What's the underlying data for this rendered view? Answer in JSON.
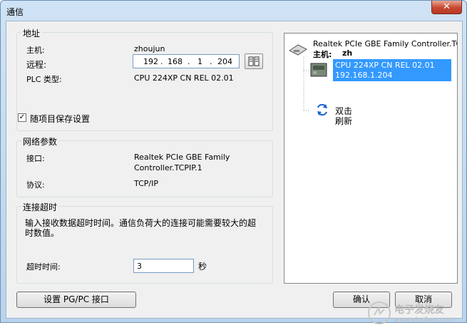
{
  "window": {
    "title": "通信",
    "close_label": "✕"
  },
  "address_group": {
    "title": "地址",
    "host_label": "主机:",
    "host_value": "zhoujun",
    "remote_label": "远程:",
    "ip": [
      "192",
      "168",
      "1",
      "204"
    ],
    "plc_type_label": "PLC 类型:",
    "plc_type_value": "CPU 224XP CN REL 02.01",
    "save_checkbox_label": "随项目保存设置",
    "save_checked": true
  },
  "network_group": {
    "title": "网络参数",
    "interface_label": "接口:",
    "interface_value_line1": "Realtek PCIe GBE Family",
    "interface_value_line2": "Controller.TCPIP.1",
    "protocol_label": "协议:",
    "protocol_value": "TCP/IP"
  },
  "timeout_group": {
    "title": "连接超时",
    "description_line1": "输入接收数据超时时间。通信负荷大的连接可能需要较大的超",
    "description_line2": "时数值。",
    "timeout_label": "超时时间:",
    "timeout_value": "3",
    "unit": "秒"
  },
  "buttons": {
    "set_pgpc": "设置 PG/PC 接口",
    "confirm": "确认",
    "cancel": "取消"
  },
  "tree": {
    "root_label": "Realtek PCIe GBE Family Controller.TCPI",
    "host_prefix": "主机:",
    "host_value": "zh",
    "device_line1": "CPU 224XP CN REL 02.01",
    "device_line2": "192.168.1.204",
    "refresh_line1": "双击",
    "refresh_line2": "刷新"
  },
  "watermark": {
    "text": "电子发烧友",
    "sub": "www.elecfans.com"
  },
  "colors": {
    "selection": "#3399ff",
    "close": "#c7472f"
  }
}
